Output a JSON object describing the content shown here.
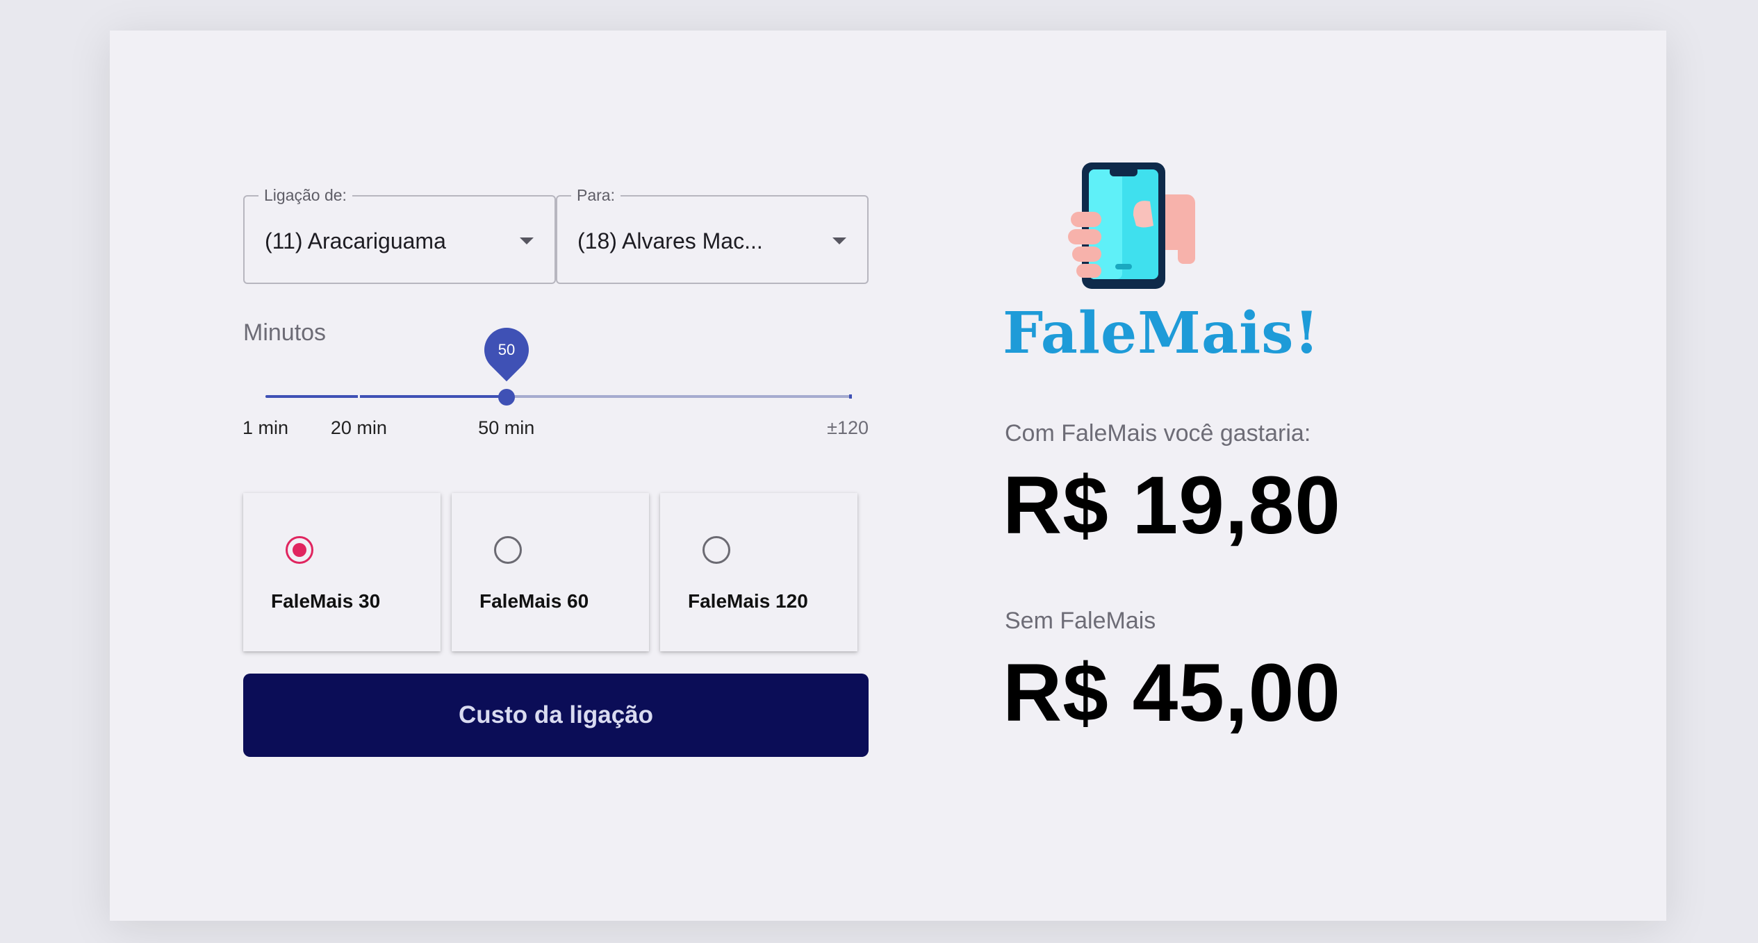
{
  "form": {
    "origin": {
      "legend": "Ligação de:",
      "value": "(11) Aracariguama"
    },
    "destination": {
      "legend": "Para:",
      "value": "(18) Alvares Mac..."
    }
  },
  "slider": {
    "label": "Minutos",
    "min": 1,
    "max": 120,
    "value": 50,
    "value_label": "50",
    "marks": [
      {
        "value": 1,
        "label": "1 min"
      },
      {
        "value": 20,
        "label": "20 min"
      },
      {
        "value": 50,
        "label": "50 min"
      },
      {
        "value": 120,
        "label": "±120"
      }
    ]
  },
  "plans": [
    {
      "label": "FaleMais 30",
      "selected": true
    },
    {
      "label": "FaleMais 60",
      "selected": false
    },
    {
      "label": "FaleMais 120",
      "selected": false
    }
  ],
  "button": {
    "label": "Custo da ligação"
  },
  "brand": {
    "name": "FaleMais!",
    "icon": "phone-in-hand-icon"
  },
  "result": {
    "with_caption": "Com FaleMais você gastaria:",
    "with_value": "R$ 19,80",
    "without_caption": "Sem FaleMais",
    "without_value": "R$ 45,00"
  },
  "colors": {
    "primary": "#3f51b5",
    "button": "#0b0d57",
    "radio_selected": "#e0255f",
    "brand_text": "#1e9bd8"
  }
}
